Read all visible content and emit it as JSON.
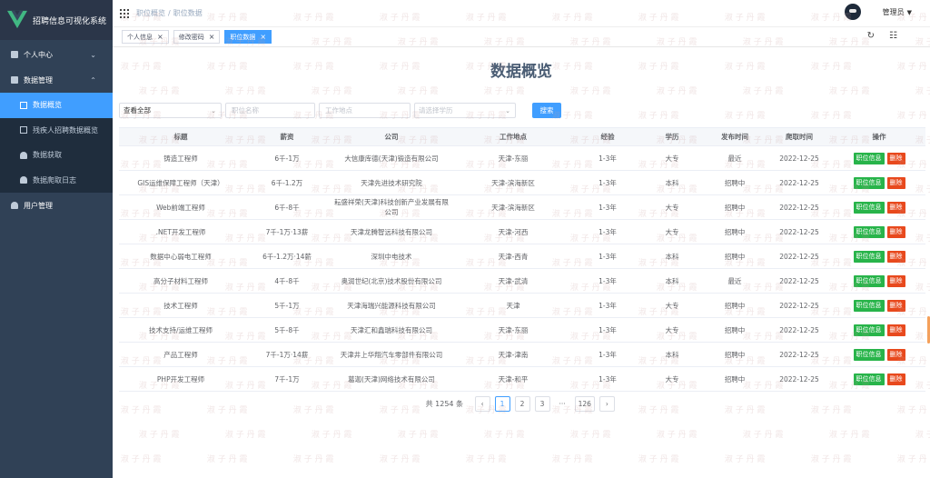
{
  "app": {
    "title": "招聘信息可视化系统"
  },
  "sidebar": {
    "items": [
      {
        "label": "个人中心"
      },
      {
        "label": "数据管理"
      },
      {
        "label": "用户管理"
      }
    ],
    "sub": [
      {
        "label": "数据概览"
      },
      {
        "label": "残疾人招聘数据概览"
      },
      {
        "label": "数据获取"
      },
      {
        "label": "数据爬取日志"
      }
    ]
  },
  "breadcrumb": {
    "first": "职位概览",
    "sep": "/",
    "second": "职位数据"
  },
  "user": {
    "name": "管理员"
  },
  "tags": [
    {
      "label": "个人信息"
    },
    {
      "label": "修改密码"
    },
    {
      "label": "职位数据"
    }
  ],
  "heading": "数据概览",
  "filters": {
    "select_value": "查看全部",
    "name_placeholder": "职位名称",
    "location_placeholder": "工作地点",
    "edu_placeholder": "请选择学历",
    "search_label": "搜索"
  },
  "table": {
    "headers": [
      "标题",
      "薪资",
      "公司",
      "工作地点",
      "经验",
      "学历",
      "发布时间",
      "爬取时间",
      "操作"
    ],
    "rows": [
      [
        "铸造工程师",
        "6千-1万",
        "大信康库德(天津)锻造有限公司",
        "天津-东丽",
        "1-3年",
        "大专",
        "最近",
        "2022-12-25"
      ],
      [
        "GIS运维保障工程师（天津）",
        "6千-1.2万",
        "天津先进技术研究院",
        "天津-滨海新区",
        "1-3年",
        "本科",
        "招聘中",
        "2022-12-25"
      ],
      [
        "Web前端工程师",
        "6千-8千",
        "耘盛祥荣(天津)科技创新产业发展有限公司",
        "天津-滨海新区",
        "1-3年",
        "大专",
        "招聘中",
        "2022-12-25"
      ],
      [
        ".NET开发工程师",
        "7千-1万·13薪",
        "天津龙腾智远科技有限公司",
        "天津-河西",
        "1-3年",
        "大专",
        "招聘中",
        "2022-12-25"
      ],
      [
        "数据中心弱电工程师",
        "6千-1.2万·14薪",
        "深圳中电技术",
        "天津-西青",
        "1-3年",
        "本科",
        "招聘中",
        "2022-12-25"
      ],
      [
        "高分子材料工程师",
        "4千-8千",
        "奥润世纪(北京)技术股份有限公司",
        "天津-武清",
        "1-3年",
        "本科",
        "最近",
        "2022-12-25"
      ],
      [
        "技术工程师",
        "5千-1万",
        "天津海瑞兴能源科技有限公司",
        "天津",
        "1-3年",
        "大专",
        "招聘中",
        "2022-12-25"
      ],
      [
        "技术支持/运维工程师",
        "5千-8千",
        "天津汇和鑫瑞科技有限公司",
        "天津-东丽",
        "1-3年",
        "大专",
        "招聘中",
        "2022-12-25"
      ],
      [
        "产品工程师",
        "7千-1万·14薪",
        "天津井上华翔汽车零部件有限公司",
        "天津-津南",
        "1-3年",
        "本科",
        "招聘中",
        "2022-12-25"
      ],
      [
        "PHP开发工程师",
        "7千-1万",
        "葛迦(天津)网络技术有限公司",
        "天津-和平",
        "1-3年",
        "大专",
        "招聘中",
        "2022-12-25"
      ]
    ],
    "op_info": "职位信息",
    "op_delete": "删除"
  },
  "pagination": {
    "total": "共 1254 条",
    "pages": [
      "1",
      "2",
      "3"
    ],
    "dots": "···",
    "last": "126",
    "prev": "‹",
    "next": "›"
  },
  "watermark": "淑 子 丹 霞",
  "colors": {
    "sidebar": "#304156",
    "accent": "#409eff",
    "success": "#28b44a",
    "danger": "#e8491d"
  }
}
